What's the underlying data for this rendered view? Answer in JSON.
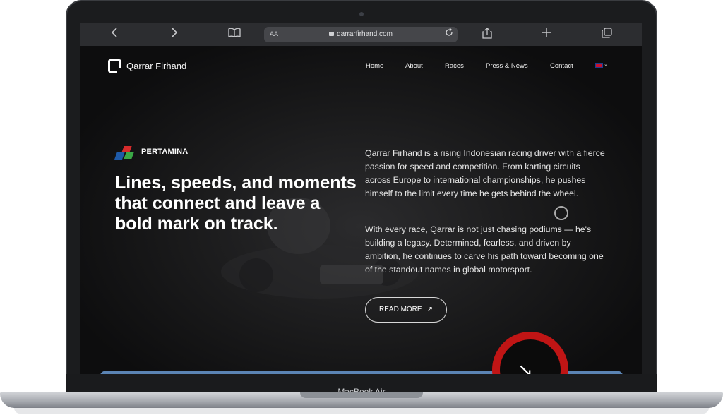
{
  "browser": {
    "url": "qarrarfirhand.com",
    "text_size_label": "AA",
    "back_icon": "chevron-left-icon",
    "forward_icon": "chevron-right-icon",
    "reader_icon": "book-icon",
    "reload_icon": "reload-icon",
    "share_icon": "share-icon",
    "new_tab_icon": "plus-icon",
    "tabs_icon": "tabs-icon"
  },
  "site": {
    "brand": "Qarrar Firhand",
    "nav": [
      "Home",
      "About",
      "Races",
      "Press & News",
      "Contact"
    ],
    "language_icon": "uk-flag-icon",
    "sponsor": "PERTAMINA",
    "headline": "Lines, speeds, and moments that connect and leave a bold mark on track.",
    "paragraph_1": "Qarrar Firhand is a rising Indonesian racing driver with a fierce passion for speed and competition. From karting circuits across Europe to international championships, he pushes himself to the limit every time he gets behind the wheel.",
    "paragraph_2": "With every race, Qarrar is not just chasing podiums — he's building a legacy. Determined, fearless, and driven by ambition, he continues to carve his path toward becoming one of the standout names in global motorsport.",
    "cta": "READ MORE",
    "cta_icon": "arrow-up-right-icon"
  },
  "device": {
    "label": "MacBook Air"
  },
  "colors": {
    "accent_red": "#c01515",
    "strip_blue": "#5b84b4",
    "page_bg": "#0d0d0e"
  }
}
